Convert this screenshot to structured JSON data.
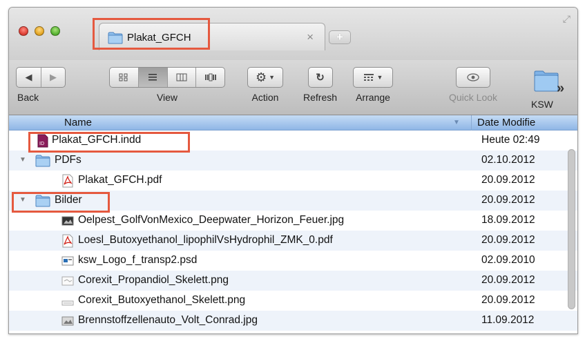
{
  "window": {
    "tab_title": "Plakat_GFCH",
    "close_tab_symbol": "×",
    "new_tab_symbol": "+"
  },
  "toolbar": {
    "back_label": "Back",
    "view_label": "View",
    "action_label": "Action",
    "refresh_label": "Refresh",
    "arrange_label": "Arrange",
    "quicklook_label": "Quick Look",
    "ksw_label": "KSW",
    "more_symbol": "»"
  },
  "columns": {
    "name": "Name",
    "date": "Date Modifie"
  },
  "files": [
    {
      "name": "Plakat_GFCH.indd",
      "date": "Heute 02:49",
      "icon": "indesign-file-icon",
      "level": 0,
      "disclosure": ""
    },
    {
      "name": "PDFs",
      "date": "02.10.2012",
      "icon": "folder-icon",
      "level": 0,
      "disclosure": "▼"
    },
    {
      "name": "Plakat_GFCH.pdf",
      "date": "20.09.2012",
      "icon": "pdf-file-icon",
      "level": 1,
      "disclosure": ""
    },
    {
      "name": "Bilder",
      "date": "20.09.2012",
      "icon": "folder-icon",
      "level": 0,
      "disclosure": "▼"
    },
    {
      "name": "Oelpest_GolfVonMexico_Deepwater_Horizon_Feuer.jpg",
      "date": "18.09.2012",
      "icon": "jpg-file-icon",
      "level": 1,
      "disclosure": ""
    },
    {
      "name": "Loesl_Butoxyethanol_lipophilVsHydrophil_ZMK_0.pdf",
      "date": "20.09.2012",
      "icon": "pdf-file-icon",
      "level": 1,
      "disclosure": ""
    },
    {
      "name": "ksw_Logo_f_transp2.psd",
      "date": "02.09.2010",
      "icon": "psd-file-icon",
      "level": 1,
      "disclosure": ""
    },
    {
      "name": "Corexit_Propandiol_Skelett.png",
      "date": "20.09.2012",
      "icon": "png-file-icon",
      "level": 1,
      "disclosure": ""
    },
    {
      "name": "Corexit_Butoxyethanol_Skelett.png",
      "date": "20.09.2012",
      "icon": "png-file-icon",
      "level": 1,
      "disclosure": ""
    },
    {
      "name": "Brennstoffzellenauto_Volt_Conrad.jpg",
      "date": "11.09.2012",
      "icon": "jpg-file-icon",
      "level": 1,
      "disclosure": ""
    }
  ],
  "colors": {
    "highlight": "#e5593f",
    "header_blue": "#8fb6e6",
    "folder_blue": "#7fb2e6"
  }
}
